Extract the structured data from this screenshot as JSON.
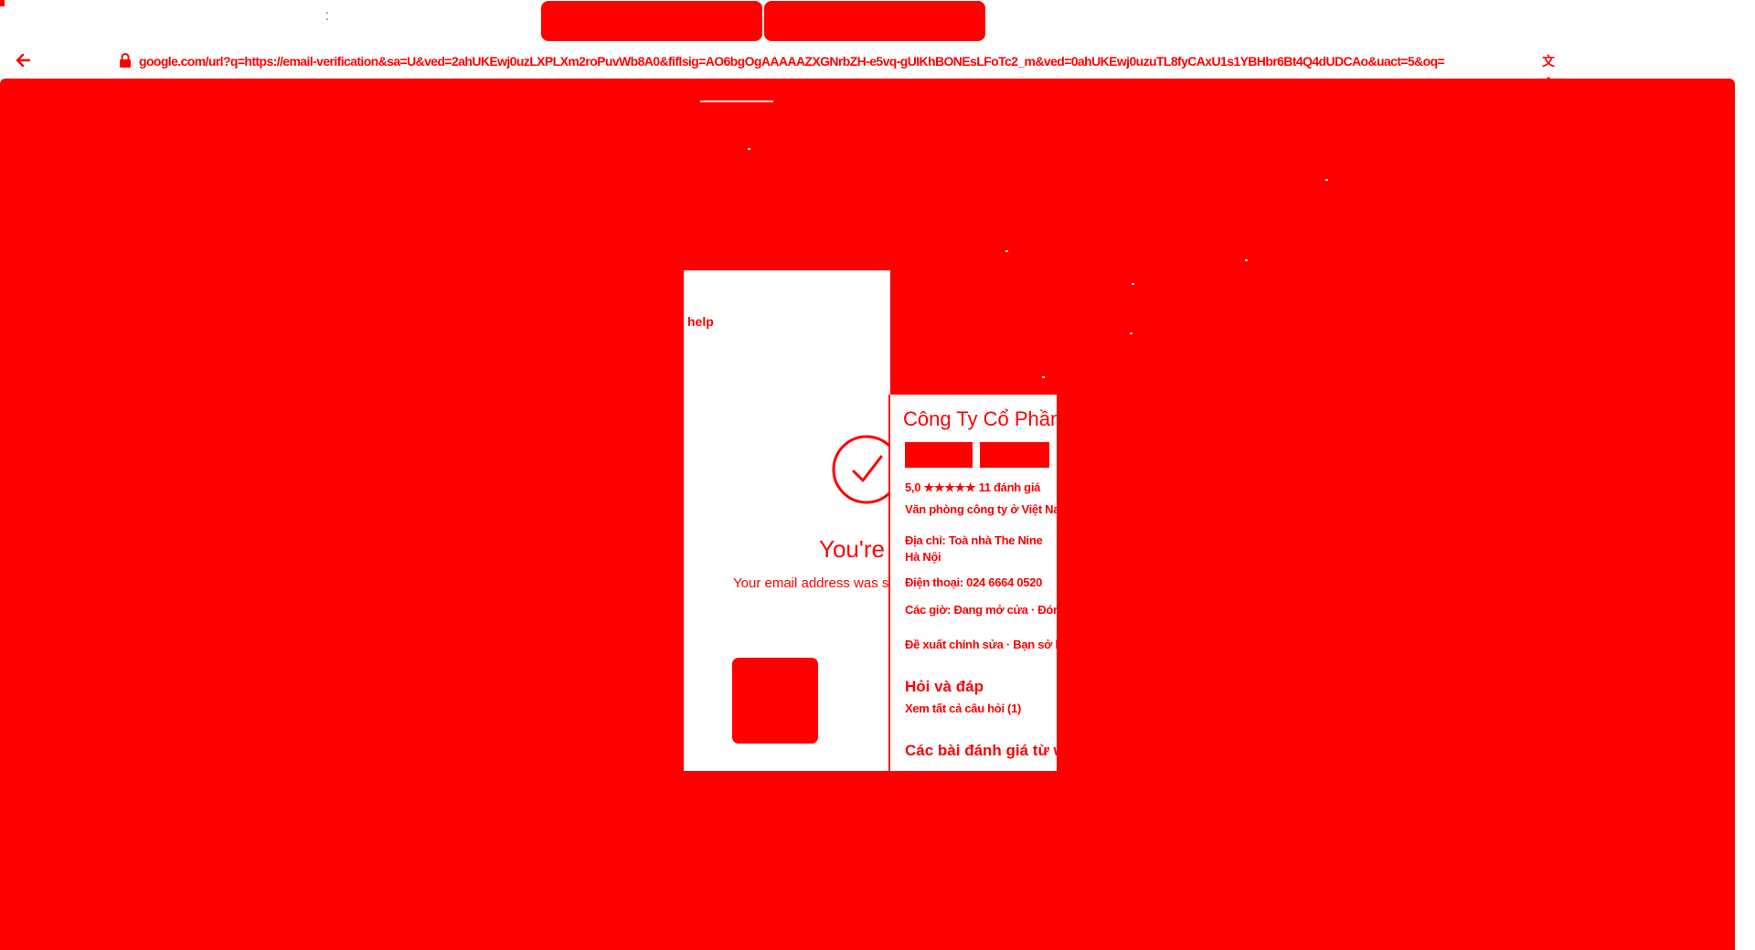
{
  "browser": {
    "tabs": [
      {
        "label": ""
      },
      {
        "label": ""
      }
    ],
    "url": "google.com/url?q=https://email-verification&sa=U&ved=2ahUKEwj0uzLXPLXm2roPuvWb8A0&fiflsig=AO6bgOgAAAAAZXGNrbZH-e5vq-gUIKhBONEsLFoTc2_m&ved=0ahUKEwj0uzuTL8fyCAxU1s1YBHbr6Bt4Q4dUDCAo&uact=5&oq=",
    "icons": {
      "back": "arrow-left-icon",
      "lock": "lock-icon",
      "translate": "translate-icon"
    }
  },
  "verify": {
    "help_label": "help",
    "title": "You're in!",
    "message": "Your email address was successfully verified.",
    "check_icon": "check-circle-icon"
  },
  "business": {
    "name": "Công Ty Cổ Phần",
    "rating_line": "5,0 ★★★★★ 11 đánh giá",
    "category": "Văn phòng công ty ở Việt Nam",
    "address": "Địa chỉ: Toà nhà The Nine",
    "city": "Hà Nội",
    "phone": "Điện thoại: 024 6664 0520",
    "hours": "Các giờ: Đang mở cửa · Đóng cửa",
    "suggest": "Đề xuất chỉnh sửa · Bạn sở hữu",
    "qa_heading": "Hỏi và đáp",
    "qa_link": "Xem tất cả câu hỏi (1)",
    "reviews_heading": "Các bài đánh giá từ web"
  },
  "colors": {
    "primary": "#ff0000",
    "background": "#ffffff"
  }
}
